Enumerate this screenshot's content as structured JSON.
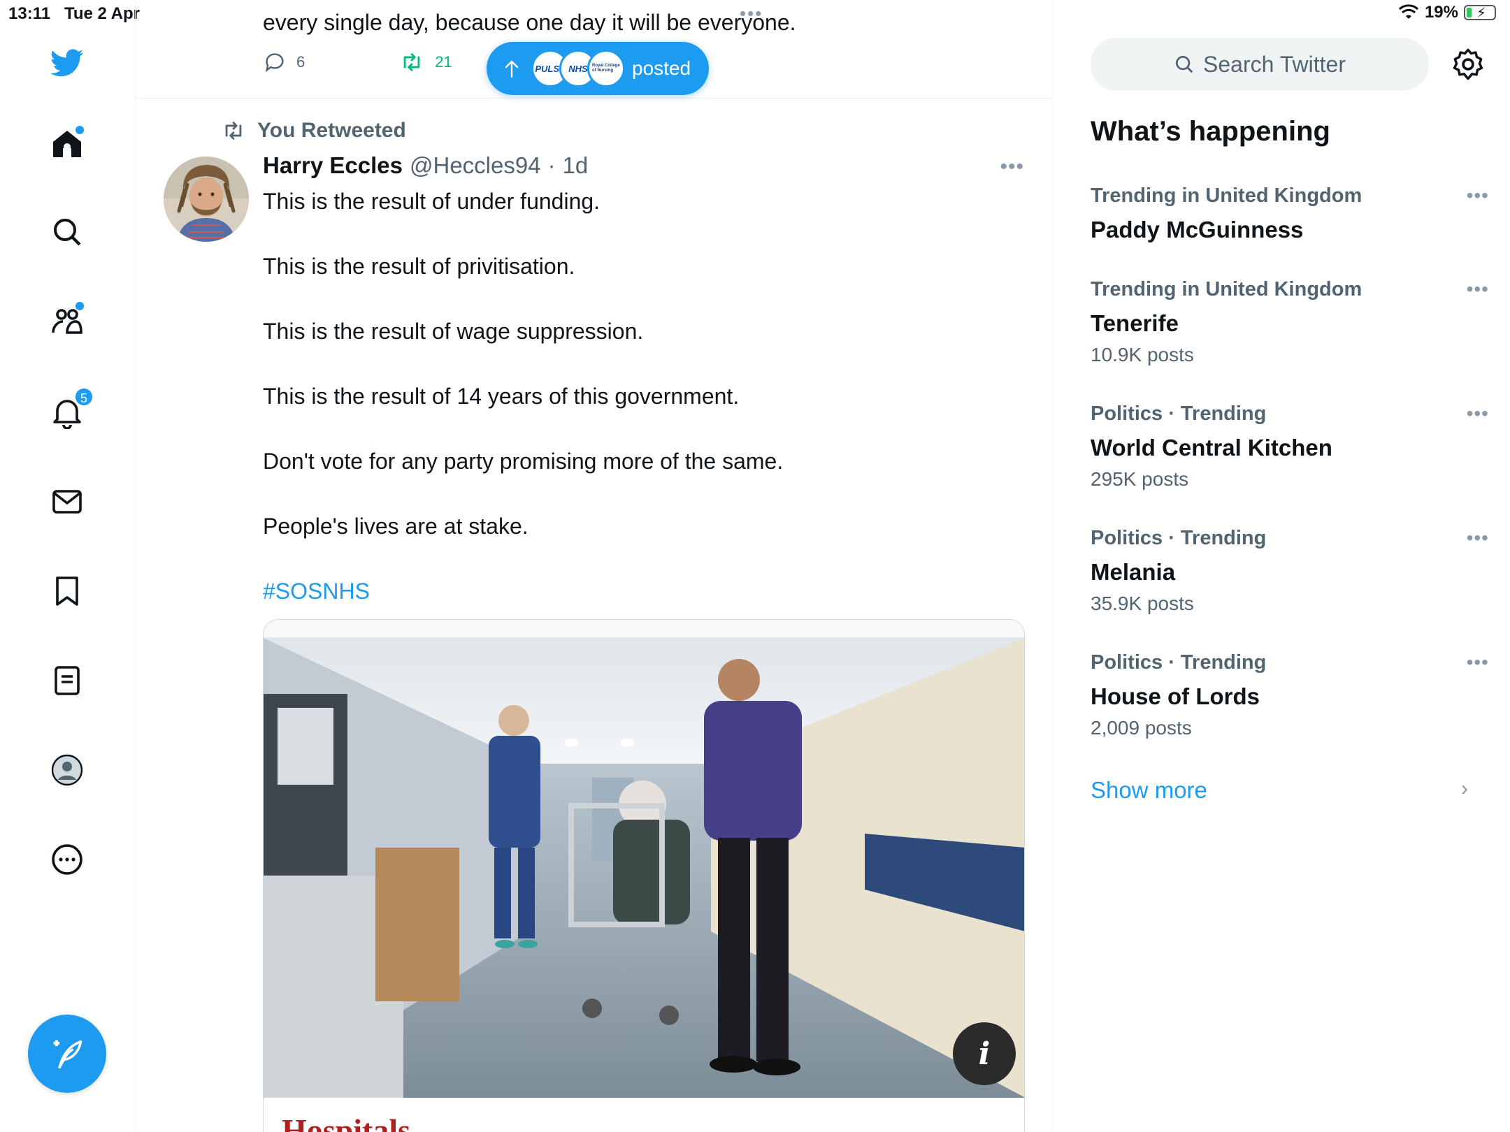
{
  "status_bar": {
    "time": "13:11",
    "date": "Tue 2 Apr",
    "multitask_dots": "•••",
    "battery_percent": "19%",
    "battery_fraction": 0.19
  },
  "nav": {
    "notifications_badge": "5",
    "icons": [
      "twitter-logo-icon",
      "home-icon",
      "search-icon",
      "communities-icon",
      "notifications-icon",
      "messages-icon",
      "bookmarks-icon",
      "lists-icon",
      "profile-icon",
      "more-icon",
      "compose-icon"
    ],
    "accent": "#1d9bf0"
  },
  "previous_tweet": {
    "text": "every single day, because one day it will be everyone.",
    "replies": "6",
    "retweets": "21"
  },
  "new_posts_pill": {
    "label": "posted",
    "avatar_labels": [
      "PULSE",
      "NHS",
      "Royal College of Nursing"
    ]
  },
  "tweet": {
    "retweet_label": "You Retweeted",
    "author_name": "Harry Eccles",
    "handle": "@Heccles94",
    "separator": "·",
    "time": "1d",
    "more": "•••",
    "lines": [
      "This is the result of under funding.",
      "This is the result of privitisation.",
      "This is the result of wage suppression.",
      "This is the result of 14 years of this government.",
      "Don't vote for any party promising more of the same.",
      "People's lives are at stake."
    ],
    "hashtag": "#SOSNHS",
    "card": {
      "info_label": "i",
      "headline": "Hospitals"
    }
  },
  "sidebar": {
    "search_placeholder": "Search Twitter",
    "heading": "What’s happening",
    "trends": [
      {
        "context": "Trending in United Kingdom",
        "topic": "Paddy McGuinness",
        "count": ""
      },
      {
        "context": "Trending in United Kingdom",
        "topic": "Tenerife",
        "count": "10.9K posts"
      },
      {
        "context": "Politics · Trending",
        "topic": "World Central Kitchen",
        "count": "295K posts"
      },
      {
        "context": "Politics · Trending",
        "topic": "Melania",
        "count": "35.9K posts"
      },
      {
        "context": "Politics · Trending",
        "topic": "House of Lords",
        "count": "2,009 posts"
      }
    ],
    "trend_more": "•••",
    "show_more": "Show more"
  }
}
